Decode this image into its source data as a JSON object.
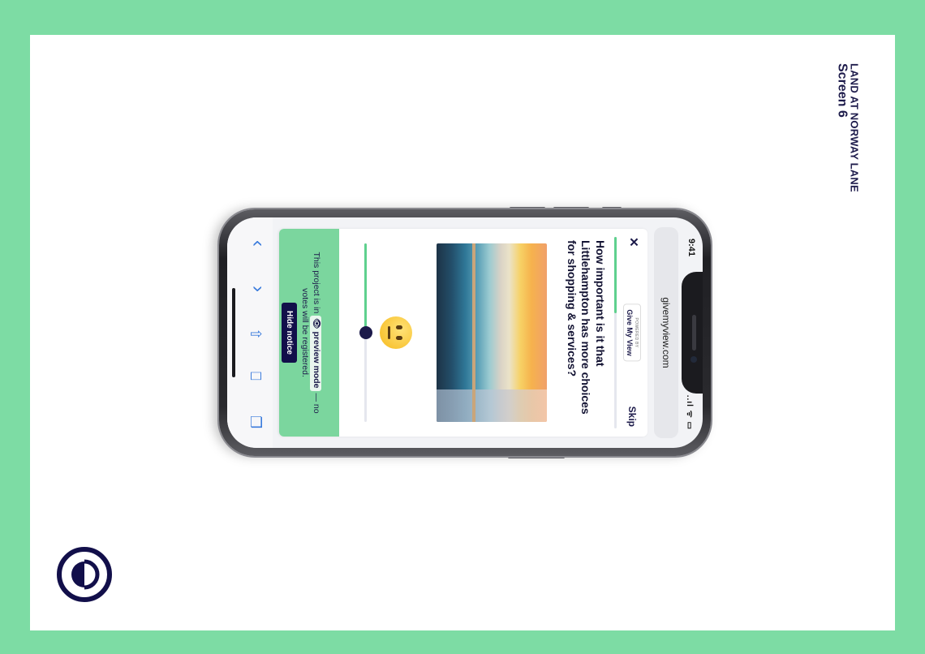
{
  "document": {
    "title_line1": "LAND AT NORWAY LANE",
    "title_line2": "Screen 6",
    "logo_icon": "half-circle-logo-icon"
  },
  "colors": {
    "accent_green": "#7ddca4",
    "navy": "#1c1a4a",
    "button_navy": "#120f4a"
  },
  "phone": {
    "status": {
      "time": "9:41",
      "icons": "..ıl ᯤ ▭"
    },
    "browser": {
      "url": "givemyview.com"
    },
    "card": {
      "close_label": "✕",
      "brand_powered": "POWERED BY",
      "brand_name": "Give My View",
      "skip_label": "Skip",
      "progress": 0.4,
      "question": "How important is it that Littlehampton has more choices for shopping & services?",
      "image_icon": "clothes-rack-photo",
      "slider": {
        "value": 0.5,
        "emoji_icon": "neutral-face-icon"
      }
    },
    "notice": {
      "text_before": "This project is in",
      "mode_label": "👁 preview mode",
      "text_after": "— no votes will be registered.",
      "hide_label": "Hide notice"
    },
    "toolbar": {
      "back": "‹",
      "forward": "›",
      "share": "⇧",
      "bookmarks": "⎕",
      "tabs": "❐"
    }
  }
}
